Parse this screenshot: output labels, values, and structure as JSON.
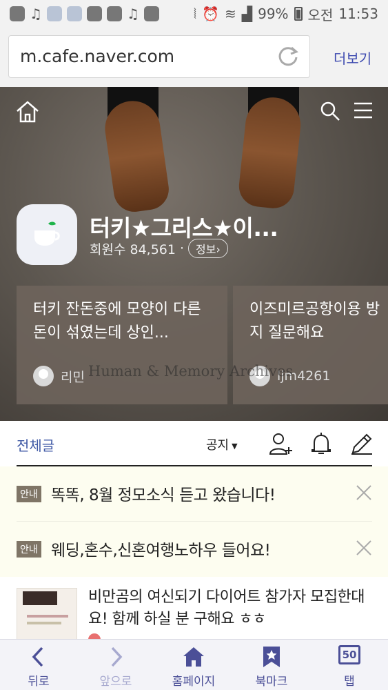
{
  "status_bar": {
    "battery": "99%",
    "ampm": "오전",
    "time": "11:53"
  },
  "browser": {
    "url": "m.cafe.naver.com",
    "more_label": "더보기"
  },
  "cafe": {
    "name": "터키★그리스★이...",
    "members_label": "회원수 84,561",
    "separator": "·",
    "info_label": "정보›"
  },
  "featured": [
    {
      "title": "터키 잔돈중에 모양이 다른 돈이 섞였는데 상인...",
      "author": "리민"
    },
    {
      "title": "이즈미르공항이용 방지 질문해요",
      "author": "ljm4261"
    }
  ],
  "watermark": "Human & Memory Archives",
  "tabs": {
    "all_label": "전체글",
    "notice_label": "공지"
  },
  "notices": [
    {
      "badge": "안내",
      "text": "똑똑, 8월 정모소식 듣고 왔습니다!"
    },
    {
      "badge": "안내",
      "text": "웨딩,혼수,신혼여행노하우 들어요!"
    }
  ],
  "post": {
    "title": "비만곰의 여신되기 다이어트 참가자 모집한대요! 함께 하실 분 구해요 ㅎㅎ"
  },
  "bottom_nav": [
    {
      "label": "뒤로"
    },
    {
      "label": "앞으로"
    },
    {
      "label": "홈페이지"
    },
    {
      "label": "북마크"
    },
    {
      "label": "탭",
      "count": "50"
    }
  ]
}
